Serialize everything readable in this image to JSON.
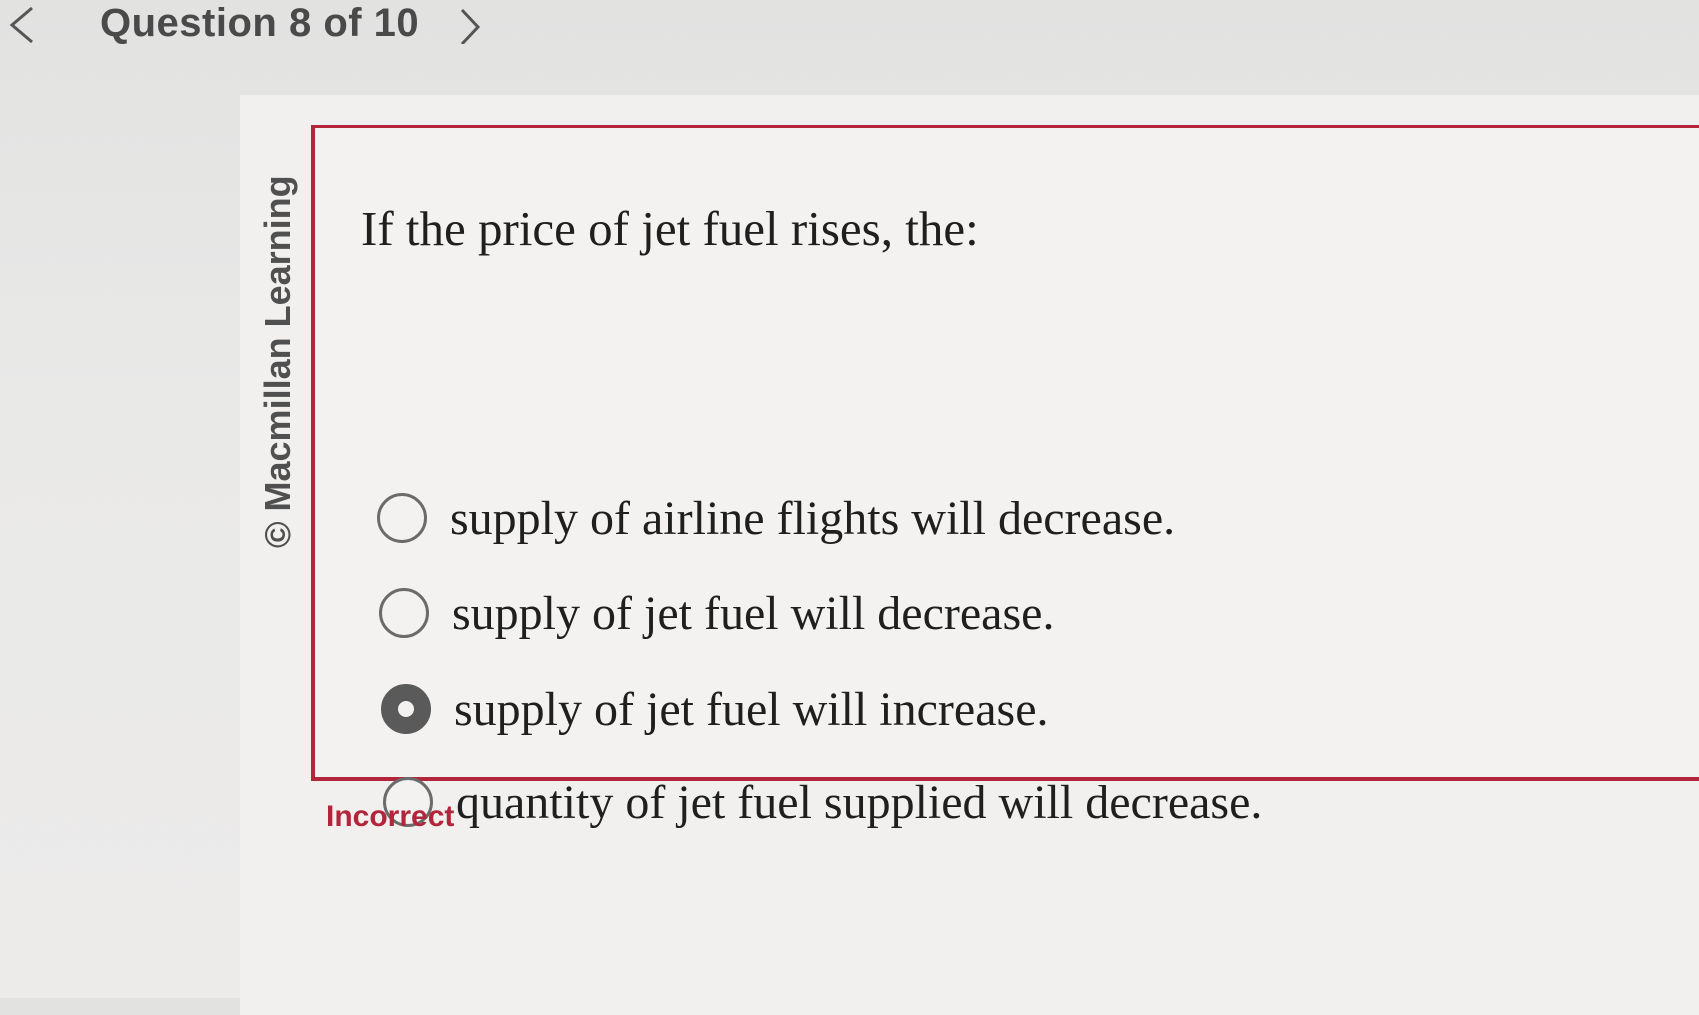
{
  "nav": {
    "counter": "Question 8 of 10",
    "prev_icon": "chevron-left-icon",
    "next_icon": "chevron-right-icon"
  },
  "copyright": "© Macmillan Learning",
  "question": {
    "text": "If the price of jet fuel rises, the:",
    "options": [
      {
        "label": "supply of airline flights will decrease.",
        "selected": false
      },
      {
        "label": "supply of jet fuel will decrease.",
        "selected": false
      },
      {
        "label": "supply of jet fuel will increase.",
        "selected": true
      },
      {
        "label": "quantity of jet fuel supplied will decrease.",
        "selected": false
      }
    ]
  },
  "feedback": "Incorrect",
  "colors": {
    "accent": "#b3253a",
    "radio_border": "#6b6b6b"
  }
}
